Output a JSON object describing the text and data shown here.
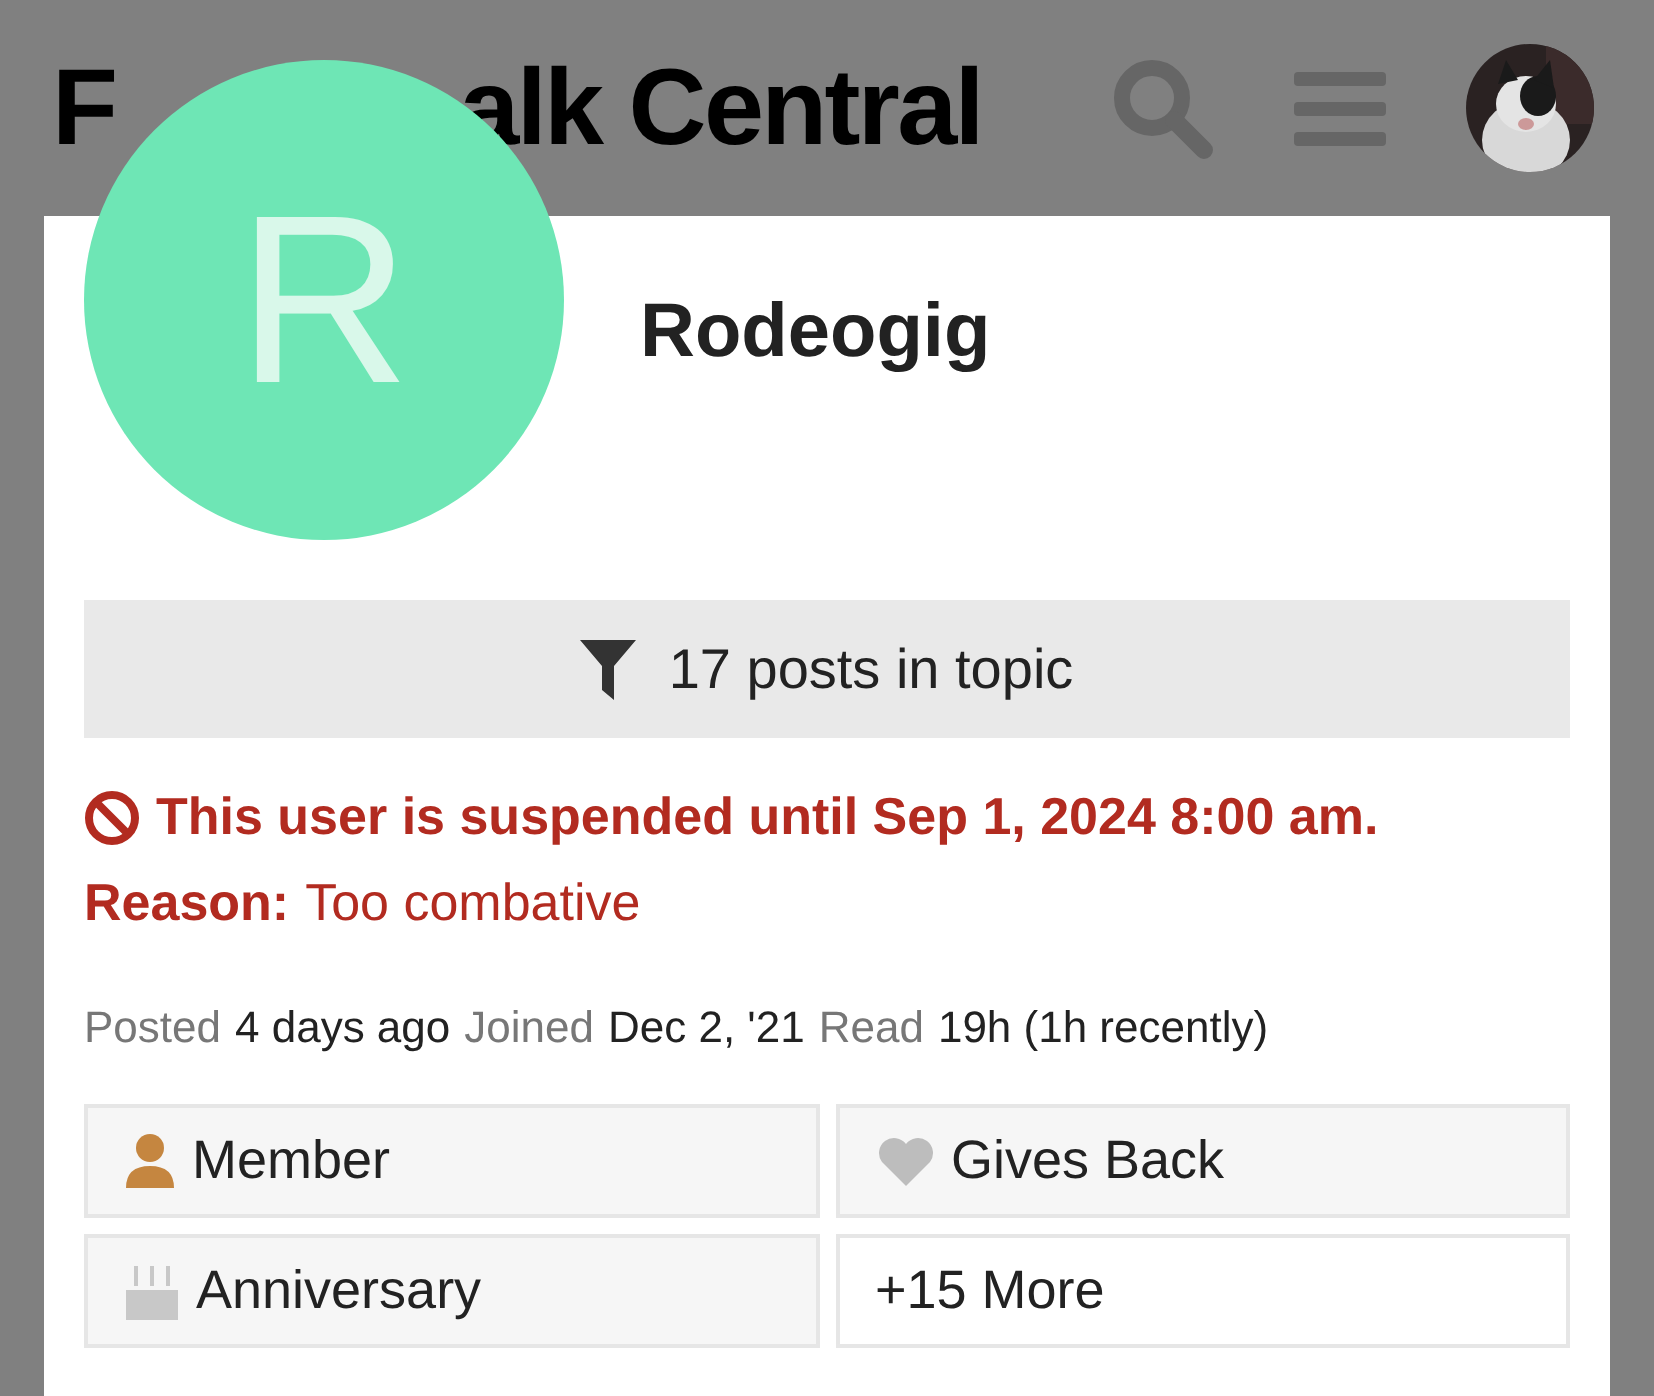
{
  "header": {
    "title_parts": [
      "F",
      "alk Central"
    ]
  },
  "user": {
    "initial": "R",
    "username": "Rodeogig"
  },
  "filter_button": {
    "label": "17 posts in topic"
  },
  "suspension": {
    "message": "This user is suspended until Sep 1, 2024 8:00 am.",
    "reason_label": "Reason:",
    "reason": "Too combative"
  },
  "meta": [
    {
      "label": "Posted",
      "value": "4 days ago"
    },
    {
      "label": "Joined",
      "value": "Dec 2, '21"
    },
    {
      "label": "Read",
      "value": "19h (1h recently)"
    }
  ],
  "badges": [
    {
      "kind": "person",
      "color": "#c58640",
      "label": "Member"
    },
    {
      "kind": "heart",
      "color": "#bdbdbd",
      "label": "Gives Back"
    },
    {
      "kind": "cake",
      "color": "#c8c8c8",
      "label": "Anniversary"
    },
    {
      "kind": "more",
      "label": "+15 More"
    }
  ]
}
